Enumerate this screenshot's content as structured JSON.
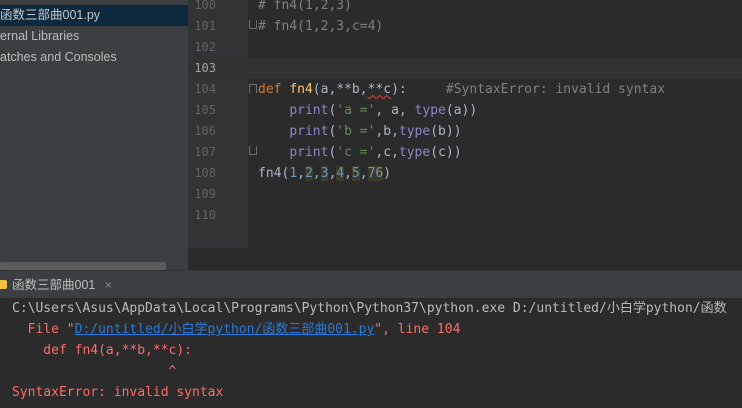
{
  "project_tree": {
    "partial_item": ".py",
    "items": [
      {
        "label": "函数三部曲001.py",
        "selected": true
      },
      {
        "label": "ernal Libraries",
        "selected": false
      },
      {
        "label": "atches and Consoles",
        "selected": false
      }
    ]
  },
  "editor": {
    "line_numbers": [
      "100",
      "101",
      "102",
      "103",
      "104",
      "105",
      "106",
      "107",
      "108",
      "109",
      "110"
    ],
    "lines": {
      "l100": "# fn4(1,2,3)",
      "l101": "# fn4(1,2,3,c=4)",
      "l104_kw": "def",
      "l104_name": "fn4",
      "l104_args_a": "(a,",
      "l104_args_b": "**b,",
      "l104_args_c": "**c",
      "l104_args_end": "):",
      "l104_comment": "#SyntaxError: invalid syntax",
      "print_kw": "print",
      "type_kw": "type",
      "l105_str": "'a ='",
      "l105_rest_a": ", a, ",
      "l105_type_arg": "(a)",
      "l106_str": "'b ='",
      "l106_rest": ",b,",
      "l106_type_arg": "(b)",
      "l107_str": "'c ='",
      "l107_rest": ",c,",
      "l107_type_arg": "(c)",
      "l108_call": "fn4",
      "l108_args": [
        "1",
        "2",
        "3",
        "4",
        "5",
        "76"
      ]
    }
  },
  "run_panel": {
    "tab_label": "函数三部曲001",
    "close_glyph": "×",
    "console": {
      "command": "C:\\Users\\Asus\\AppData\\Local\\Programs\\Python\\Python37\\python.exe D:/untitled/小白学python/函数",
      "file_prefix": "  File \"",
      "file_link": "D:/untitled/小白学python/函数三部曲001.py",
      "file_suffix": "\", line 104",
      "code_line": "    def fn4(a,**b,**c):",
      "caret_line": "                    ^",
      "error": "SyntaxError: invalid syntax"
    }
  },
  "colors": {
    "background": "#2b2b2b",
    "panel": "#3c3f41",
    "keyword": "#cc7832",
    "function": "#ffc66d",
    "string": "#6a8759",
    "number": "#6897bb",
    "comment": "#808080",
    "error": "#ff6b68",
    "link": "#287bde"
  }
}
